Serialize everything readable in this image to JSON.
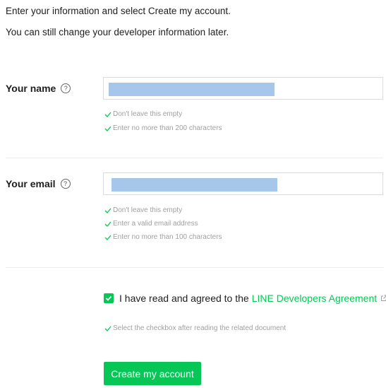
{
  "intro": {
    "line1": "Enter your information and select Create my account.",
    "line2": "You can still change your developer information later."
  },
  "name_field": {
    "label": "Your name",
    "help_icon": "?",
    "value": "",
    "hints": [
      "Don't leave this empty",
      "Enter no more than 200 characters"
    ]
  },
  "email_field": {
    "label": "Your email",
    "help_icon": "?",
    "value": "",
    "hints": [
      "Don't leave this empty",
      "Enter a valid email address",
      "Enter no more than 100 characters"
    ]
  },
  "agreement": {
    "checked": true,
    "text_before": "I have read and agreed to the",
    "link_text": "LINE Developers Agreement",
    "text_after": ".",
    "hint": "Select the checkbox after reading the related document"
  },
  "submit": {
    "label": "Create my account"
  },
  "colors": {
    "accent": "#06c755",
    "hint": "#a0a0a0",
    "redaction": "#a7c7ea"
  },
  "icons": {
    "help": "help-circle-icon",
    "check": "check-icon",
    "external": "external-link-icon"
  }
}
